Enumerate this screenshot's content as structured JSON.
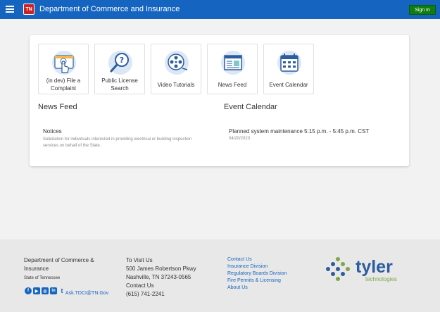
{
  "header": {
    "logo_text": "TN",
    "title": "Department of Commerce and Insurance",
    "signin_label": "Sign In"
  },
  "tiles": [
    {
      "label": "(in dev) File a Complaint",
      "icon": "file-complaint-icon"
    },
    {
      "label": "Public License Search",
      "icon": "license-search-icon"
    },
    {
      "label": "Video Tutorials",
      "icon": "film-reel-icon"
    },
    {
      "label": "News Feed",
      "icon": "newspaper-icon"
    },
    {
      "label": "Event Calendar",
      "icon": "calendar-icon"
    }
  ],
  "news_feed": {
    "title": "News Feed",
    "items": [
      {
        "title": "Notices",
        "description": "Solicitation for individuals interested in providing electrical or building inspection services on behalf of the State."
      }
    ]
  },
  "event_calendar": {
    "title": "Event Calendar",
    "items": [
      {
        "title": "Planned system maintenance 5:15 p.m. - 5:45 p.m. CST",
        "date": "04/20/2023"
      }
    ]
  },
  "footer": {
    "org_line1": "Department of Commerce &",
    "org_line2": "Insurance",
    "org_state": "State of Tennessee",
    "ask_link": "Ask.TDCI@TN.Gov",
    "visit_heading": "To Visit Us",
    "address1": "500 James Robertson Pkwy",
    "address2": "Nashville, TN 37243-0565",
    "contact_heading": "Contact Us",
    "phone": "(615) 741-2241",
    "links": [
      "Contact Us",
      "Insurance Division",
      "Regulatory Boards Division",
      "Fire Permits & Licensing",
      "About Us"
    ],
    "vendor_name": "tyler",
    "vendor_sub": "technologies"
  },
  "social": {
    "facebook_glyph": "f",
    "youtube_glyph": "▶",
    "instagram_glyph": "◎",
    "linkedin_glyph": "in",
    "twitter_glyph": "t"
  },
  "colors": {
    "header_bg": "#1565c0",
    "signin_bg": "#0f7d0f",
    "tyler_blue": "#2c5d9e",
    "tyler_green": "#7fa64a"
  }
}
